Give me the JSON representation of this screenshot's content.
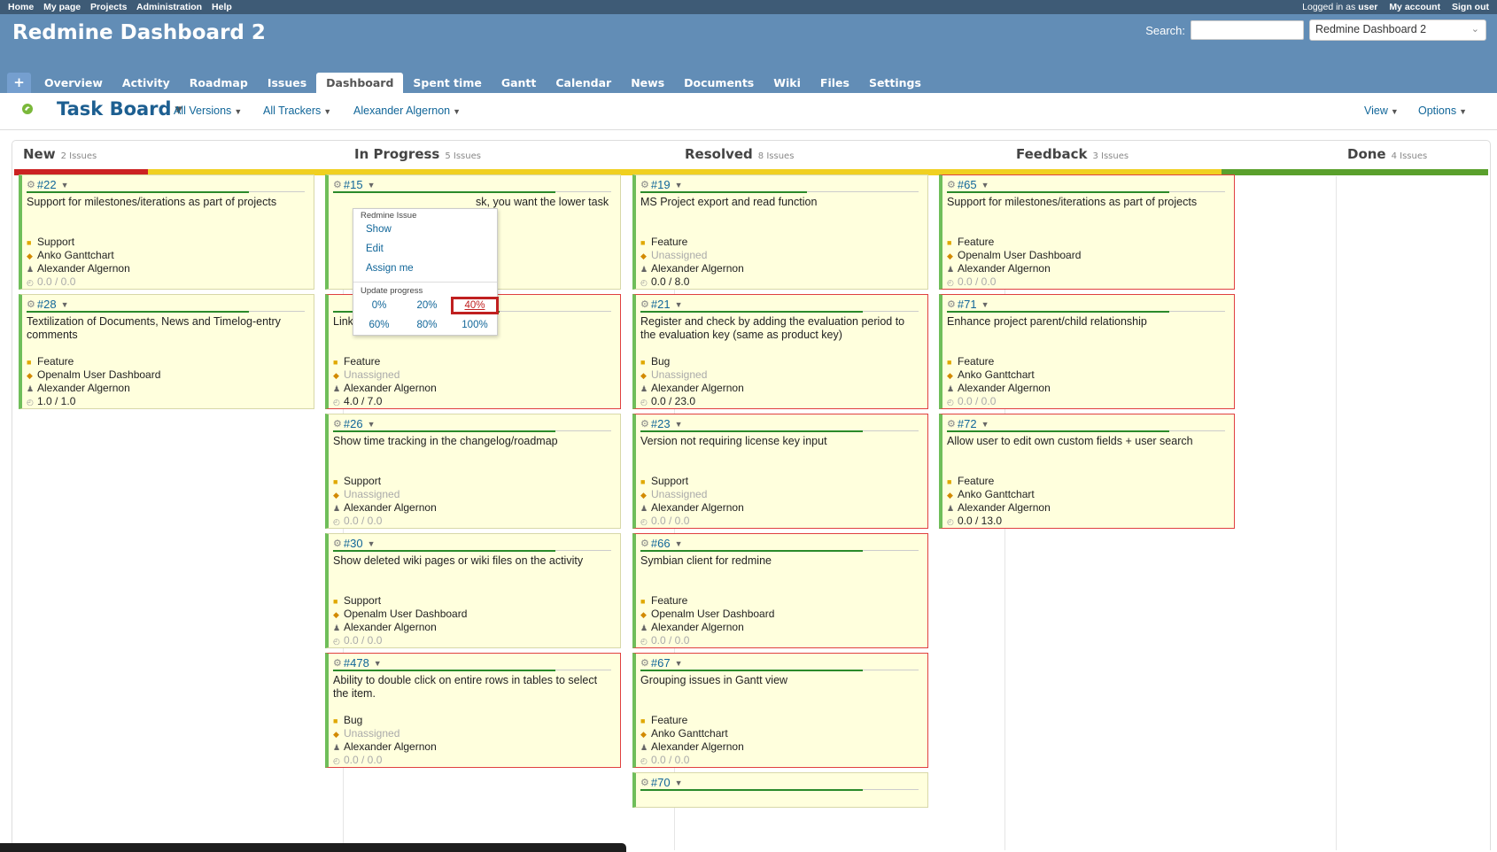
{
  "top_menu": {
    "links": [
      "Home",
      "My page",
      "Projects",
      "Administration",
      "Help"
    ],
    "logged_in_prefix": "Logged in as",
    "logged_in_user": "user",
    "my_account": "My account",
    "sign_out": "Sign out"
  },
  "header": {
    "title": "Redmine Dashboard 2",
    "search_label": "Search:",
    "search_value": "",
    "project_select": "Redmine Dashboard 2"
  },
  "main_menu": {
    "plus": "+",
    "tabs": [
      "Overview",
      "Activity",
      "Roadmap",
      "Issues",
      "Dashboard",
      "Spent time",
      "Gantt",
      "Calendar",
      "News",
      "Documents",
      "Wiki",
      "Files",
      "Settings"
    ],
    "selected": "Dashboard"
  },
  "context": {
    "title": "Task Board",
    "versions": "All Versions",
    "trackers": "All Trackers",
    "assignee": "Alexander Algernon",
    "view": "View",
    "options": "Options"
  },
  "columns": [
    {
      "name": "New",
      "count": "2 Issues"
    },
    {
      "name": "In Progress",
      "count": "5 Issues"
    },
    {
      "name": "Resolved",
      "count": "8 Issues"
    },
    {
      "name": "Feedback",
      "count": "3 Issues"
    },
    {
      "name": "Done",
      "count": "4 Issues"
    }
  ],
  "colors": {
    "red": "#cc2222",
    "yellow": "#f0d020",
    "green": "#5aa02c",
    "card_bg": "#ffffdd",
    "overdue_border": "#e04040"
  },
  "cards": [
    {
      "id": "#22",
      "subject": "Support for milestones/iterations as part of projects",
      "tracker": "Support",
      "version": "Anko Ganttchart",
      "assignee": "Alexander Algernon",
      "time": "0.0 / 0.0",
      "progress": 0.8,
      "overdue": false
    },
    {
      "id": "#28",
      "subject": "Textilization of Documents, News and Timelog-entry comments",
      "tracker": "Feature",
      "version": "Openalm User Dashboard",
      "assignee": "Alexander Algernon",
      "time": "1.0 / 1.0",
      "progress": 0.8,
      "overdue": false
    },
    {
      "id": "#15",
      "subject": "sk, you want the lower task to",
      "tracker": "",
      "version": "",
      "assignee": "",
      "time": "",
      "progress": 0.8,
      "overdue": false
    },
    {
      "id": "",
      "subject": "Link tasks with Drag & Drop",
      "tracker": "Feature",
      "version": "Unassigned",
      "assignee": "Alexander Algernon",
      "time": "4.0 / 7.0",
      "progress": 0.6,
      "overdue": true
    },
    {
      "id": "#26",
      "subject": "Show time tracking in the changelog/roadmap",
      "tracker": "Support",
      "version": "Unassigned",
      "assignee": "Alexander Algernon",
      "time": "0.0 / 0.0",
      "progress": 0.8,
      "overdue": false
    },
    {
      "id": "#30",
      "subject": "Show deleted wiki pages or wiki files on the activity",
      "tracker": "Support",
      "version": "Openalm User Dashboard",
      "assignee": "Alexander Algernon",
      "time": "0.0 / 0.0",
      "progress": 0.8,
      "overdue": false
    },
    {
      "id": "#478",
      "subject": "Ability to double click on entire rows in tables to select the item.",
      "tracker": "Bug",
      "version": "Unassigned",
      "assignee": "Alexander Algernon",
      "time": "0.0 / 0.0",
      "progress": 0.8,
      "overdue": true
    },
    {
      "id": "#19",
      "subject": "MS Project export and read function",
      "tracker": "Feature",
      "version": "Unassigned",
      "assignee": "Alexander Algernon",
      "time": "0.0 / 8.0",
      "progress": 0.6,
      "overdue": false
    },
    {
      "id": "#21",
      "subject": "Register and check by adding the evaluation period to the evaluation key (same as product key)",
      "tracker": "Bug",
      "version": "Unassigned",
      "assignee": "Alexander Algernon",
      "time": "0.0 / 23.0",
      "progress": 0.8,
      "overdue": true
    },
    {
      "id": "#23",
      "subject": "Version not requiring license key input",
      "tracker": "Support",
      "version": "Unassigned",
      "assignee": "Alexander Algernon",
      "time": "0.0 / 0.0",
      "progress": 0.8,
      "overdue": true
    },
    {
      "id": "#66",
      "subject": "Symbian client for redmine",
      "tracker": "Feature",
      "version": "Openalm User Dashboard",
      "assignee": "Alexander Algernon",
      "time": "0.0 / 0.0",
      "progress": 0.8,
      "overdue": true
    },
    {
      "id": "#67",
      "subject": "Grouping issues in Gantt view",
      "tracker": "Feature",
      "version": "Anko Ganttchart",
      "assignee": "Alexander Algernon",
      "time": "0.0 / 0.0",
      "progress": 0.8,
      "overdue": true
    },
    {
      "id": "#70",
      "subject": "",
      "tracker": "",
      "version": "",
      "assignee": "",
      "time": "",
      "progress": 0.8,
      "overdue": false
    },
    {
      "id": "#65",
      "subject": "Support for milestones/iterations as part of projects",
      "tracker": "Feature",
      "version": "Openalm User Dashboard",
      "assignee": "Alexander Algernon",
      "time": "0.0 / 0.0",
      "progress": 0.8,
      "overdue": true
    },
    {
      "id": "#71",
      "subject": "Enhance project parent/child relationship",
      "tracker": "Feature",
      "version": "Anko Ganttchart",
      "assignee": "Alexander Algernon",
      "time": "0.0 / 0.0",
      "progress": 0.8,
      "overdue": true
    },
    {
      "id": "#72",
      "subject": "Allow user to edit own custom fields + user search",
      "tracker": "Feature",
      "version": "Anko Ganttchart",
      "assignee": "Alexander Algernon",
      "time": "0.0 / 13.0",
      "progress": 0.8,
      "overdue": true
    }
  ],
  "popup": {
    "section1": "Redmine Issue",
    "items": [
      "Show",
      "Edit",
      "Assign me"
    ],
    "section2": "Update progress",
    "progress_options": [
      "0%",
      "20%",
      "40%",
      "60%",
      "80%",
      "100%"
    ],
    "selected_option": "40%"
  }
}
